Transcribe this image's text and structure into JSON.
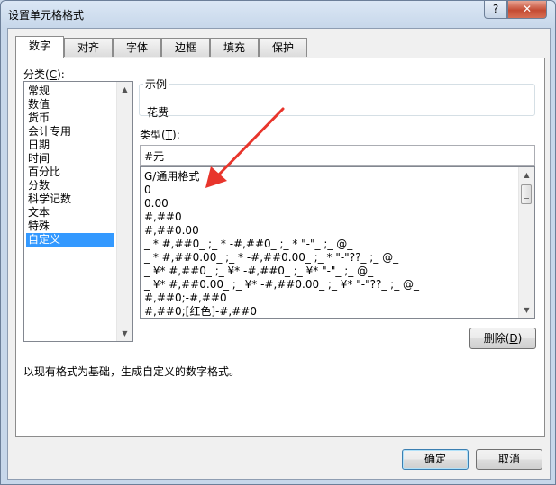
{
  "dialog": {
    "title": "设置单元格格式",
    "help_glyph": "?",
    "close_glyph": "✕"
  },
  "tabs": [
    {
      "label": "数字"
    },
    {
      "label": "对齐"
    },
    {
      "label": "字体"
    },
    {
      "label": "边框"
    },
    {
      "label": "填充"
    },
    {
      "label": "保护"
    }
  ],
  "category": {
    "label_pre": "分类(",
    "label_key": "C",
    "label_post": "):",
    "items": [
      "常规",
      "数值",
      "货币",
      "会计专用",
      "日期",
      "时间",
      "百分比",
      "分数",
      "科学记数",
      "文本",
      "特殊",
      "自定义"
    ],
    "selected_index": 11
  },
  "sample": {
    "label": "示例",
    "value": "花费"
  },
  "type": {
    "label_pre": "类型(",
    "label_key": "T",
    "label_post": "):",
    "value": "#元",
    "formats": [
      "G/通用格式",
      "0",
      "0.00",
      "#,##0",
      "#,##0.00",
      "_ * #,##0_ ;_ * -#,##0_ ;_ * \"-\"_ ;_ @_",
      "_ * #,##0.00_ ;_ * -#,##0.00_ ;_ * \"-\"??_ ;_ @_",
      "_ ¥* #,##0_ ;_ ¥* -#,##0_ ;_ ¥* \"-\"_ ;_ @_",
      "_ ¥* #,##0.00_ ;_ ¥* -#,##0.00_ ;_ ¥* \"-\"??_ ;_ @_",
      "#,##0;-#,##0",
      "#,##0;[红色]-#,##0"
    ]
  },
  "delete_button": {
    "label_pre": "删除(",
    "label_key": "D",
    "label_post": ")"
  },
  "description": "以现有格式为基础，生成自定义的数字格式。",
  "footer": {
    "ok_label": "确定",
    "cancel_label": "取消"
  },
  "colors": {
    "selection": "#3399ff",
    "annotation_arrow": "#e8352c"
  }
}
